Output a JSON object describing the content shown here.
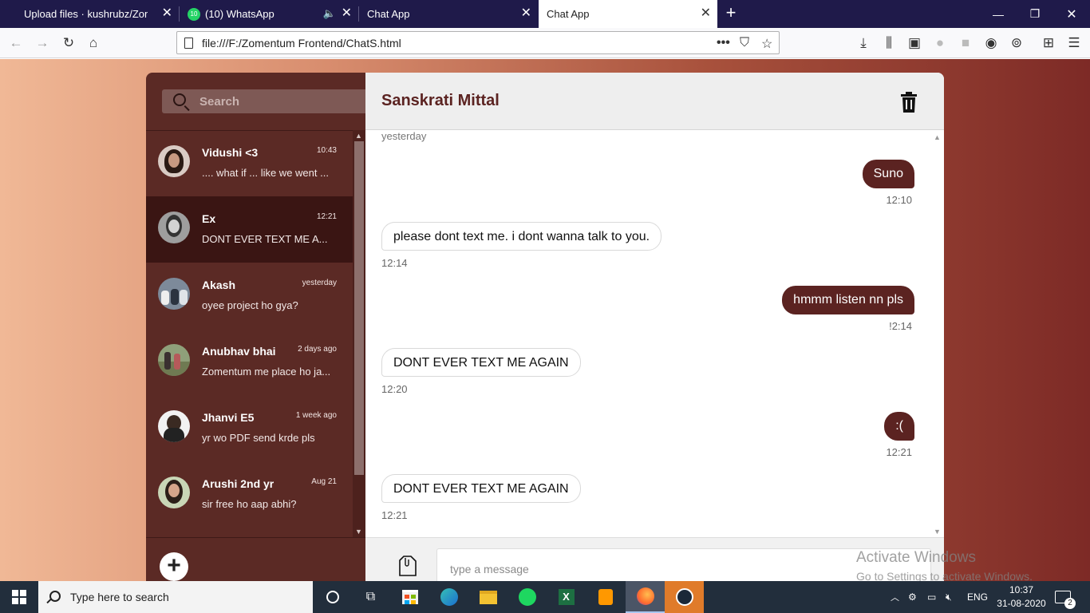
{
  "browser": {
    "tabs": [
      {
        "title": "Upload files · kushrubz/Zomentum",
        "active": false
      },
      {
        "title": "(10) WhatsApp",
        "active": false,
        "badge": "10"
      },
      {
        "title": "Chat App",
        "active": false
      },
      {
        "title": "Chat App",
        "active": true
      }
    ],
    "url": "file:///F:/Zomentum Frontend/ChatS.html"
  },
  "sidebar": {
    "search_placeholder": "Search",
    "contacts": [
      {
        "name": "Vidushi <3",
        "time": "10:43",
        "preview": ".... what if ... like we went ...",
        "active": false
      },
      {
        "name": "Ex",
        "time": "12:21",
        "preview": "DONT EVER TEXT ME A...",
        "active": true
      },
      {
        "name": "Akash",
        "time": "yesterday",
        "preview": "oyee project ho gya?",
        "active": false
      },
      {
        "name": "Anubhav bhai",
        "time": "2 days ago",
        "preview": "Zomentum me place ho ja...",
        "active": false
      },
      {
        "name": "Jhanvi E5",
        "time": "1 week ago",
        "preview": "yr wo PDF send krde pls",
        "active": false
      },
      {
        "name": "Arushi 2nd yr",
        "time": "Aug 21",
        "preview": "sir free ho aap abhi?",
        "active": false
      }
    ],
    "add_label": "+"
  },
  "chat": {
    "title": "Sanskrati Mittal",
    "day_label": "yesterday",
    "messages": [
      {
        "dir": "sent",
        "text": "Suno",
        "time": "12:10"
      },
      {
        "dir": "recv",
        "text": "please dont text me. i dont wanna talk to you.",
        "time": "12:14"
      },
      {
        "dir": "sent",
        "text": "hmmm listen nn pls",
        "time": "!2:14"
      },
      {
        "dir": "recv",
        "text": "DONT EVER TEXT ME AGAIN",
        "time": "12:20"
      },
      {
        "dir": "sent",
        "text": ":(",
        "time": "12:21"
      },
      {
        "dir": "recv",
        "text": "DONT EVER TEXT ME AGAIN",
        "time": "12:21"
      }
    ],
    "input_placeholder": "type a message"
  },
  "watermark": {
    "line1": "Activate Windows",
    "line2": "Go to Settings to activate Windows."
  },
  "taskbar": {
    "search_placeholder": "Type here to search",
    "language": "ENG",
    "time": "10:37",
    "date": "31-08-2020",
    "notifications": "2"
  },
  "colors": {
    "sidebar": "#5b2a25",
    "active_contact": "#3a1513",
    "sent_bubble": "#5b2321",
    "title": "#5b2321"
  }
}
